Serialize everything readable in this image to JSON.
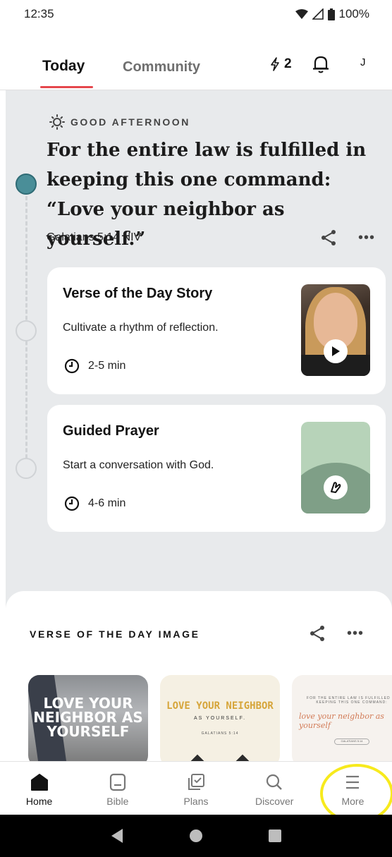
{
  "status_bar": {
    "time": "12:35",
    "battery": "100%"
  },
  "header": {
    "tabs": [
      {
        "label": "Today"
      },
      {
        "label": "Community"
      }
    ],
    "streak_count": "2",
    "avatar_initial": "J"
  },
  "today": {
    "greeting": "GOOD AFTERNOON",
    "verse_text": "For the entire law is fulfilled in keeping this one command: “Love your neighbor as yourself.”",
    "verse_reference": "Galatians 5:14 NIV",
    "more_label": "•••",
    "cards": [
      {
        "title": "Verse of the Day Story",
        "description": "Cultivate a rhythm of reflection.",
        "duration": "2-5 min"
      },
      {
        "title": "Guided Prayer",
        "description": "Start a conversation with God.",
        "duration": "4-6 min"
      }
    ]
  },
  "votd_image": {
    "section_title": "VERSE OF THE DAY IMAGE",
    "more_label": "•••",
    "images": [
      {
        "text": "LOVE YOUR NEIGHBOR AS YOURSELF"
      },
      {
        "title": "LOVE YOUR NEIGHBOR",
        "subtitle": "AS YOURSELF.",
        "reference": "GALATIANS 5:14"
      },
      {
        "top_text": "FOR THE ENTIRE LAW IS FULFILLED IN KEEPING THIS ONE COMMAND:",
        "script": "love your neighbor as yourself",
        "pill": "GALATIANS 5:14"
      }
    ]
  },
  "bottom_nav": [
    {
      "label": "Home",
      "icon": "home-icon",
      "active": true
    },
    {
      "label": "Bible",
      "icon": "bible-icon"
    },
    {
      "label": "Plans",
      "icon": "plans-icon"
    },
    {
      "label": "Discover",
      "icon": "search-icon"
    },
    {
      "label": "More",
      "icon": "menu-icon"
    }
  ],
  "colors": {
    "accent": "#e5484d",
    "timeline_active": "#4a8e98",
    "highlight": "#f7ea1d",
    "background": "#e8eaec"
  }
}
